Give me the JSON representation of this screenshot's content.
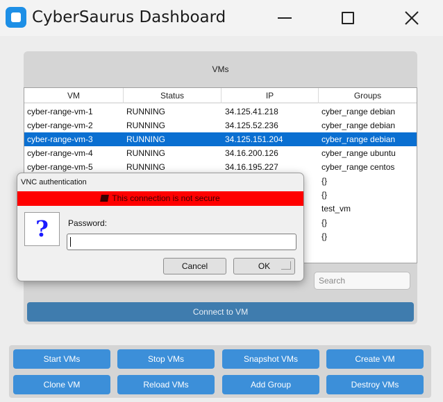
{
  "window": {
    "title": "CyberSaurus Dashboard"
  },
  "vms_panel": {
    "label": "VMs",
    "columns": [
      "VM",
      "Status",
      "IP",
      "Groups"
    ],
    "rows": [
      {
        "vm": "cyber-range-vm-1",
        "status": "RUNNING",
        "ip": "34.125.41.218",
        "groups": "cyber_range debian"
      },
      {
        "vm": "cyber-range-vm-2",
        "status": "RUNNING",
        "ip": "34.125.52.236",
        "groups": "cyber_range debian"
      },
      {
        "vm": "cyber-range-vm-3",
        "status": "RUNNING",
        "ip": "34.125.151.204",
        "groups": "cyber_range debian"
      },
      {
        "vm": "cyber-range-vm-4",
        "status": "RUNNING",
        "ip": "34.16.200.126",
        "groups": "cyber_range ubuntu"
      },
      {
        "vm": "cyber-range-vm-5",
        "status": "RUNNING",
        "ip": "34.16.195.227",
        "groups": "cyber_range centos"
      },
      {
        "vm": "",
        "status": "",
        "ip": "",
        "groups": "{}"
      },
      {
        "vm": "",
        "status": "",
        "ip": "",
        "groups": "{}"
      },
      {
        "vm": "",
        "status": "",
        "ip": "",
        "groups": "test_vm"
      },
      {
        "vm": "",
        "status": "",
        "ip": "",
        "groups": "{}"
      },
      {
        "vm": "",
        "status": "",
        "ip": "",
        "groups": "{}"
      }
    ],
    "selected_row": 2,
    "search_placeholder": "Search",
    "connect_label": "Connect to VM"
  },
  "actions": {
    "row1": [
      "Start VMs",
      "Stop VMs",
      "Snapshot VMs",
      "Create VM"
    ],
    "row2": [
      "Clone VM",
      "Reload VMs",
      "Add Group",
      "Destroy VMs"
    ]
  },
  "dialog": {
    "title": "VNC authentication",
    "warning": "This connection is not secure",
    "question_glyph": "?",
    "password_label": "Password:",
    "password_value": "",
    "cancel_label": "Cancel",
    "ok_label": "OK"
  },
  "colors": {
    "accent": "#3c8fd9",
    "selection": "#0a6fd1",
    "warning_bg": "#ff0000",
    "connect_button": "#3f7cae"
  }
}
